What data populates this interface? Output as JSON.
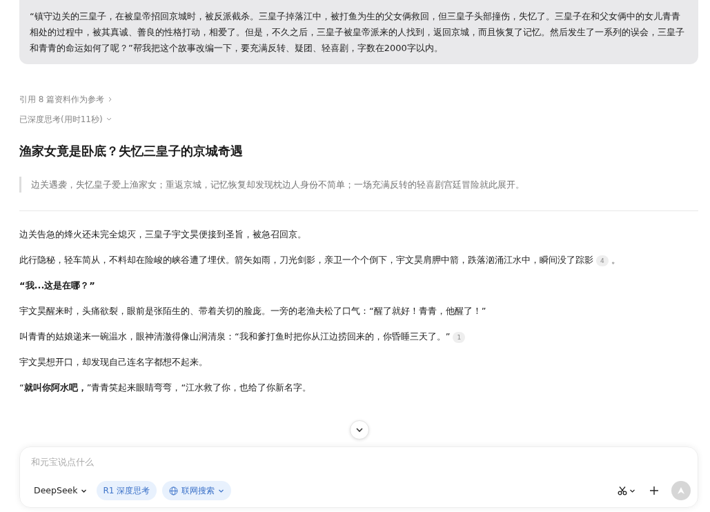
{
  "user_message": "“镇守边关的三皇子，在被皇帝招回京城时，被反派截杀。三皇子掉落江中，被打鱼为生的父女俩救回，但三皇子头部撞伤，失忆了。三皇子在和父女俩中的女儿青青相处的过程中，被其真诚、善良的性格打动，相爱了。但是，不久之后，三皇子被皇帝派来的人找到，返回京城，而且恢复了记忆。然后发生了一系列的误会，三皇子和青青的命运如何了呢？”帮我把这个故事改编一下，要充满反转、疑团、轻喜剧，字数在2000字以内。",
  "references": {
    "label": "引用 8 篇资料作为参考",
    "expanded": false
  },
  "thinking": {
    "label": "已深度思考(用时11秒)",
    "expanded": false
  },
  "story_title": "渔家女竟是卧底？失忆三皇子的京城奇遇",
  "summary": "边关遇袭，失忆皇子爱上渔家女；重返京城，记忆恢复却发现枕边人身份不简单；一场充满反转的轻喜剧宫廷冒险就此展开。",
  "paragraphs": [
    {
      "kind": "narration",
      "text": "边关告急的烽火还未完全熄灭，三皇子宇文昊便接到圣旨，被急召回京。"
    },
    {
      "kind": "narration",
      "text": "此行隐秘，轻车简从，不料却在险峻的峡谷遭了埋伏。箭矢如雨，刀光剑影，亲卫一个个倒下，宇文昊肩胛中箭，跌落汹涌江水中，瞬间没了踪影",
      "citation": "4",
      "tail": "。"
    },
    {
      "kind": "dialogue",
      "text": "“我...这是在哪？”"
    },
    {
      "kind": "narration",
      "text": "宇文昊醒来时，头痛欲裂，眼前是张陌生的、带着关切的脸庞。一旁的老渔夫松了口气：“醒了就好！青青，他醒了！”"
    },
    {
      "kind": "narration",
      "text": "叫青青的姑娘递来一碗温水，眼神清澈得像山涧清泉：“我和爹打鱼时把你从江边捞回来的，你昏睡三天了。”",
      "citation": "1"
    },
    {
      "kind": "narration",
      "text": "宇文昊想开口，却发现自己连名字都想不起来。"
    },
    {
      "kind": "narration",
      "text": "“**就叫你阿水吧，**”青青笑起来眼睛弯弯，“江水救了你，也给了你新名字。"
    }
  ],
  "composer": {
    "placeholder": "和元宝说点什么",
    "model": "DeepSeek",
    "toggles": [
      {
        "kind": "deep",
        "label": "R1 深度思考",
        "selected": true
      },
      {
        "kind": "web",
        "label": "联网搜索",
        "selected": true
      }
    ]
  }
}
